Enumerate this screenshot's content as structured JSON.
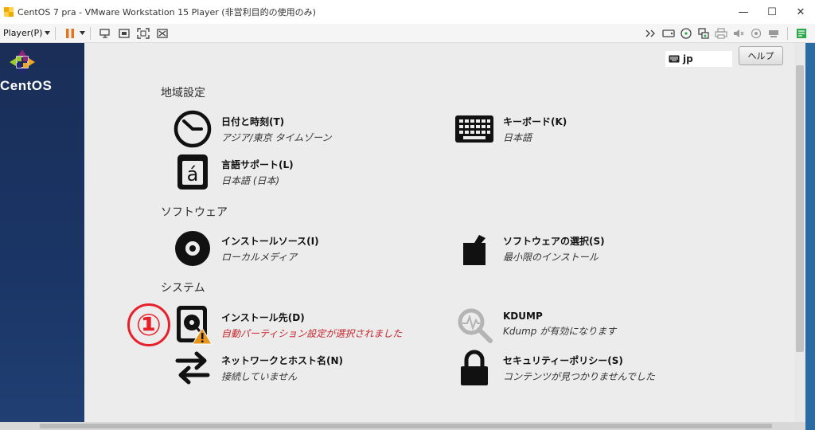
{
  "window": {
    "title": "CentOS 7 pra - VMware Workstation 15 Player (非営利目的の使用のみ)",
    "controls": {
      "minimize": "—",
      "maximize": "☐",
      "close": "✕"
    }
  },
  "toolbar": {
    "player_label": "Player(P)"
  },
  "sidebar": {
    "brand": "CentOS"
  },
  "main": {
    "keyboard_indicator": "jp",
    "help_label": "ヘルプ",
    "annotation": "①",
    "sections": {
      "localization": "地域設定",
      "software": "ソフトウェア",
      "system": "システム"
    },
    "spokes": {
      "datetime": {
        "title": "日付と時刻(T)",
        "status": "アジア/東京 タイムゾーン"
      },
      "keyboard": {
        "title": "キーボード(K)",
        "status": "日本語"
      },
      "language": {
        "title": "言語サポート(L)",
        "status": "日本語 (日本)"
      },
      "source": {
        "title": "インストールソース(I)",
        "status": "ローカルメディア"
      },
      "software_selection": {
        "title": "ソフトウェアの選択(S)",
        "status": "最小限のインストール"
      },
      "destination": {
        "title": "インストール先(D)",
        "status": "自動パーティション設定が選択されました"
      },
      "kdump": {
        "title": "KDUMP",
        "status": "Kdump が有効になります"
      },
      "network": {
        "title": "ネットワークとホスト名(N)",
        "status": "接続していません"
      },
      "security": {
        "title": "セキュリティーポリシー(S)",
        "status": "コンテンツが見つかりませんでした"
      }
    }
  },
  "colors": {
    "warning_text": "#c4262e",
    "annotation": "#e8202a",
    "pause_orange": "#e8731a"
  }
}
